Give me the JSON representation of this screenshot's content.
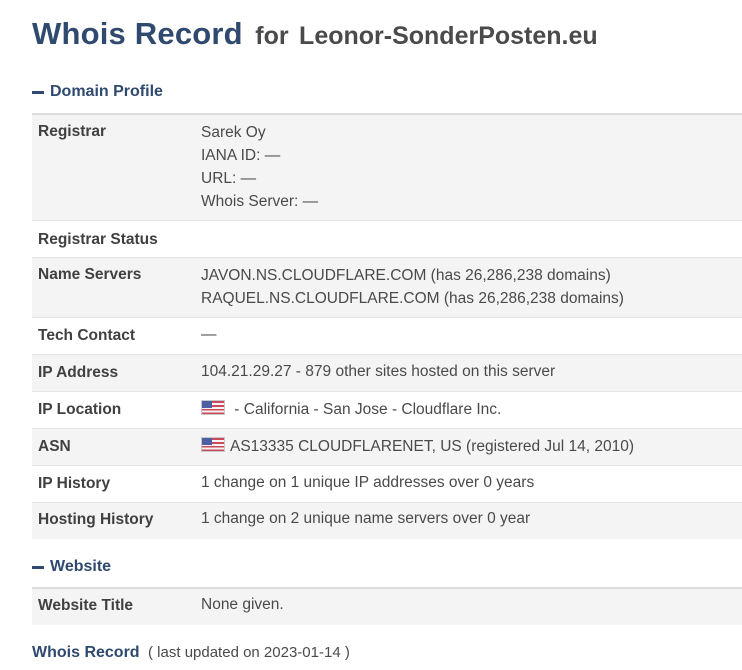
{
  "header": {
    "title": "Whois Record",
    "for_text": "for",
    "domain": "Leonor-SonderPosten.eu"
  },
  "domain_profile": {
    "heading": "Domain Profile",
    "registrar": {
      "label": "Registrar",
      "name": "Sarek Oy",
      "iana": "IANA ID: —",
      "url": "URL: —",
      "whois_server": "Whois Server: —"
    },
    "registrar_status": {
      "label": "Registrar Status",
      "value": ""
    },
    "name_servers": {
      "label": "Name Servers",
      "values": [
        "JAVON.NS.CLOUDFLARE.COM (has 26,286,238 domains)",
        "RAQUEL.NS.CLOUDFLARE.COM (has 26,286,238 domains)"
      ]
    },
    "tech_contact": {
      "label": "Tech Contact",
      "value": "—"
    },
    "ip_address": {
      "label": "IP Address",
      "value": "104.21.29.27 - 879 other sites hosted on this server"
    },
    "ip_location": {
      "label": "IP Location",
      "value": " - California - San Jose - Cloudflare Inc.",
      "flag_icon": "us-flag-icon"
    },
    "asn": {
      "label": "ASN",
      "value": "AS13335 CLOUDFLARENET, US (registered Jul 14, 2010)",
      "flag_icon": "us-flag-icon"
    },
    "ip_history": {
      "label": "IP History",
      "value": "1 change on 1 unique IP addresses over 0 years"
    },
    "hosting_history": {
      "label": "Hosting History",
      "value": "1 change on 2 unique name servers over 0 year"
    }
  },
  "website": {
    "heading": "Website",
    "website_title": {
      "label": "Website Title",
      "value": "None given."
    }
  },
  "footer": {
    "title": "Whois Record",
    "note": "( last updated on 2023-01-14 )"
  },
  "colors": {
    "heading": "#2f4a6e",
    "text": "#4a4a4a",
    "row_shade": "#f4f4f4",
    "divider": "#e4e4e4"
  }
}
